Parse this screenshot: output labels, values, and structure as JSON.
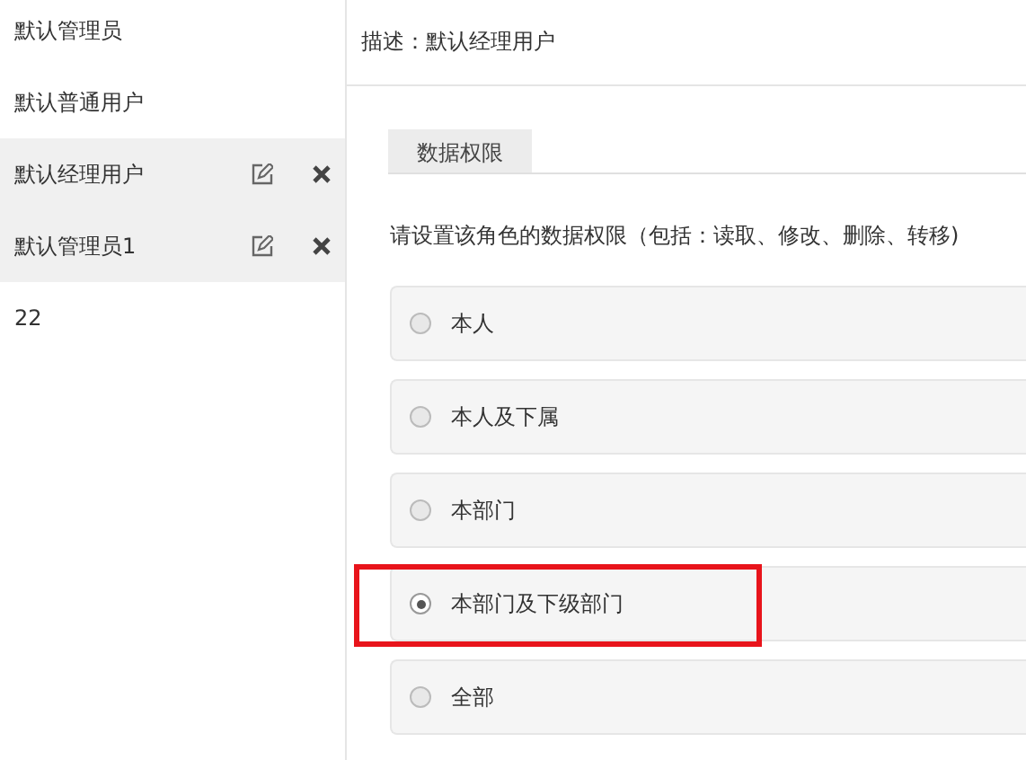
{
  "sidebar": {
    "items": [
      {
        "label": "默认管理员",
        "highlighted": false
      },
      {
        "label": "默认普通用户",
        "highlighted": false
      },
      {
        "label": "默认经理用户",
        "highlighted": true
      },
      {
        "label": "默认管理员1",
        "highlighted": true
      },
      {
        "label": "22",
        "highlighted": false
      }
    ]
  },
  "description": "描述：默认经理用户",
  "tabs": [
    {
      "label": "数据权限",
      "selected": true
    }
  ],
  "instruction": "请设置该角色的数据权限（包括：读取、修改、删除、转移)",
  "options": [
    {
      "label": "本人",
      "selected": false,
      "annotated": false
    },
    {
      "label": "本人及下属",
      "selected": false,
      "annotated": false
    },
    {
      "label": "本部门",
      "selected": false,
      "annotated": false
    },
    {
      "label": "本部门及下级部门",
      "selected": true,
      "annotated": true
    },
    {
      "label": "全部",
      "selected": false,
      "annotated": false
    }
  ]
}
